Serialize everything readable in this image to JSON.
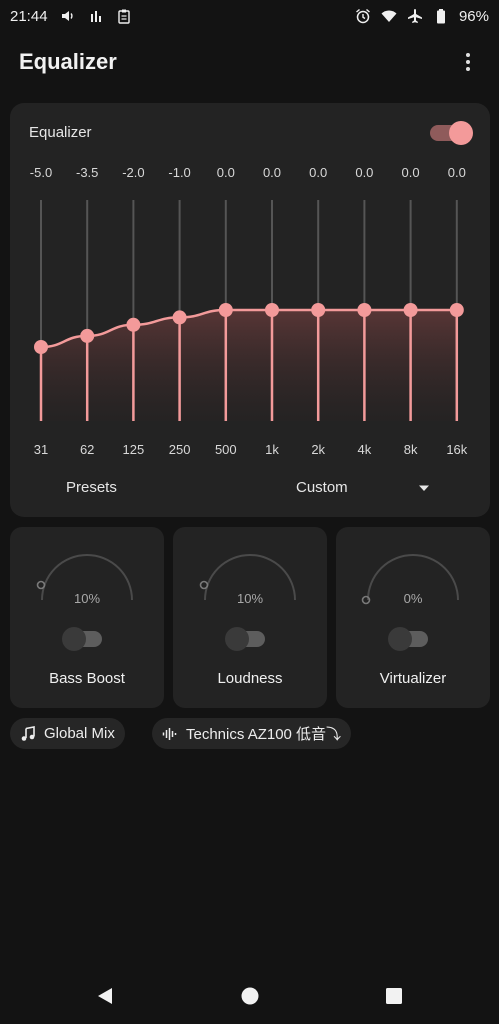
{
  "status": {
    "time": "21:44",
    "battery": "96%"
  },
  "appbar": {
    "title": "Equalizer",
    "menu_icon": "more-vert-icon"
  },
  "equalizer": {
    "label": "Equalizer",
    "enabled": true,
    "accent_color": "#f39a9a",
    "bands": [
      {
        "freq": "31",
        "gain": "-5.0"
      },
      {
        "freq": "62",
        "gain": "-3.5"
      },
      {
        "freq": "125",
        "gain": "-2.0"
      },
      {
        "freq": "250",
        "gain": "-1.0"
      },
      {
        "freq": "500",
        "gain": "0.0"
      },
      {
        "freq": "1k",
        "gain": "0.0"
      },
      {
        "freq": "2k",
        "gain": "0.0"
      },
      {
        "freq": "4k",
        "gain": "0.0"
      },
      {
        "freq": "8k",
        "gain": "0.0"
      },
      {
        "freq": "16k",
        "gain": "0.0"
      }
    ],
    "presets_label": "Presets",
    "preset_value": "Custom"
  },
  "effects": [
    {
      "name": "Bass Boost",
      "value": "10%",
      "level": 0.1,
      "enabled": false
    },
    {
      "name": "Loudness",
      "value": "10%",
      "level": 0.1,
      "enabled": false
    },
    {
      "name": "Virtualizer",
      "value": "0%",
      "level": 0.0,
      "enabled": false
    }
  ],
  "chips": {
    "global_mix": "Global Mix",
    "device": "Technics AZ100 低音⤵"
  },
  "nav": {
    "back_icon": "back-triangle-icon",
    "home_icon": "home-circle-icon",
    "recents_icon": "recents-square-icon"
  }
}
